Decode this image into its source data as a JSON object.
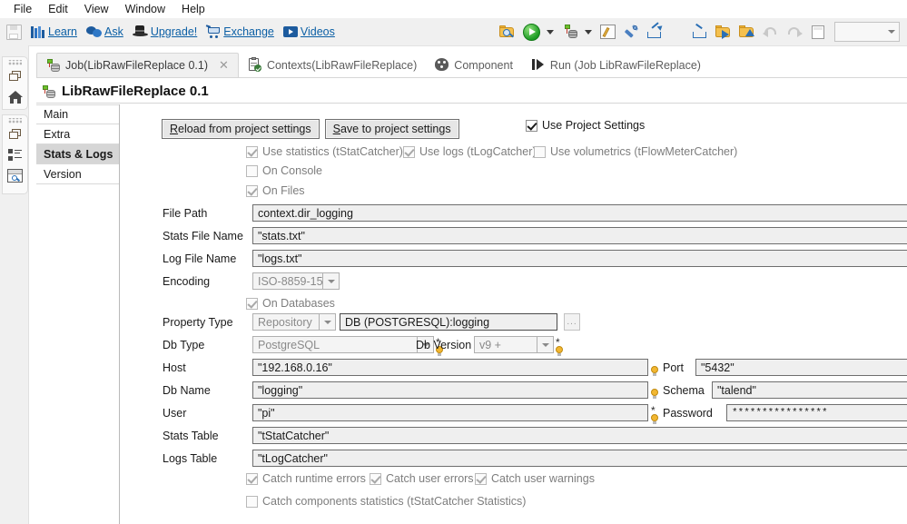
{
  "menu": {
    "items": [
      "File",
      "Edit",
      "View",
      "Window",
      "Help"
    ]
  },
  "toolbar": {
    "links": [
      {
        "icon": "books-icon",
        "label": "Learn"
      },
      {
        "icon": "speech-bubbles-icon",
        "label": "Ask"
      },
      {
        "icon": "magician-hat-icon",
        "label": "Upgrade!"
      },
      {
        "icon": "shopping-cart-icon",
        "label": "Exchange"
      },
      {
        "icon": "video-play-icon",
        "label": "Videos"
      }
    ],
    "save_icon": "save-disk-icon",
    "right_icons": [
      "find-in-repository-icon",
      "run-job-icon",
      "dropdown-caret",
      "database-connection-icon",
      "dropdown-caret",
      "edit-properties-icon",
      "build-tools-icon",
      "export-job-icon",
      "import-items-icon",
      "import-folder-icon",
      "export-folder-icon",
      "undo-icon",
      "redo-icon",
      "new-page-icon"
    ],
    "perspective_value": ""
  },
  "editor": {
    "tabs": [
      {
        "icon": "job-icon",
        "label": "Job(LibRawFileReplace 0.1)",
        "active": true,
        "closable": true
      },
      {
        "icon": "contexts-icon",
        "label": "Contexts(LibRawFileReplace)",
        "active": false,
        "closable": false
      },
      {
        "icon": "component-palette-icon",
        "label": "Component",
        "active": false,
        "closable": false
      },
      {
        "icon": "run-icon",
        "label": "Run (Job LibRawFileReplace)",
        "active": false,
        "closable": false
      }
    ],
    "title": "LibRawFileReplace 0.1",
    "title_icon": "job-icon"
  },
  "sidebar_rail": {
    "group1": [
      "restore-view-icon",
      "home-icon"
    ],
    "group2": [
      "restore-view-icon",
      "outline-icon",
      "inspect-window-icon"
    ]
  },
  "vtabs": [
    {
      "label": "Main",
      "selected": false
    },
    {
      "label": "Extra",
      "selected": false
    },
    {
      "label": "Stats & Logs",
      "selected": true
    },
    {
      "label": "Version",
      "selected": false
    }
  ],
  "form": {
    "buttons": {
      "reload": "Reload from project settings",
      "save": "Save to project settings"
    },
    "use_project_settings": {
      "label": "Use Project Settings",
      "checked": true,
      "enabled": true
    },
    "checkboxes_row1": [
      {
        "label": "Use statistics (tStatCatcher)",
        "checked": true,
        "enabled": false
      },
      {
        "label": "Use logs (tLogCatcher)",
        "checked": true,
        "enabled": false
      },
      {
        "label": "Use volumetrics (tFlowMeterCatcher)",
        "checked": false,
        "enabled": false
      }
    ],
    "on_console": {
      "label": "On Console",
      "checked": false,
      "enabled": false
    },
    "on_files": {
      "label": "On Files",
      "checked": true,
      "enabled": false
    },
    "on_databases": {
      "label": "On Databases",
      "checked": true,
      "enabled": false
    },
    "fields": {
      "file_path": {
        "label": "File Path",
        "value": "context.dir_logging"
      },
      "stats_file_name": {
        "label": "Stats File Name",
        "value": "\"stats.txt\""
      },
      "log_file_name": {
        "label": "Log File Name",
        "value": "\"logs.txt\""
      },
      "encoding": {
        "label": "Encoding",
        "value": "ISO-8859-15"
      },
      "property_type": {
        "label": "Property Type",
        "value": "Repository",
        "repository_value": "DB (POSTGRESQL):logging",
        "browse": "..."
      },
      "db_type": {
        "label": "Db Type",
        "value": "PostgreSQL"
      },
      "db_version": {
        "label": "Db Version",
        "value": "v9 +"
      },
      "host": {
        "label": "Host",
        "value": "\"192.168.0.16\""
      },
      "port": {
        "label": "Port",
        "value": "\"5432\""
      },
      "db_name": {
        "label": "Db Name",
        "value": "\"logging\""
      },
      "schema": {
        "label": "Schema",
        "value": "\"talend\""
      },
      "user": {
        "label": "User",
        "value": "\"pi\""
      },
      "password": {
        "label": "Password",
        "value": "****************"
      },
      "stats_table": {
        "label": "Stats Table",
        "value": "\"tStatCatcher\""
      },
      "logs_table": {
        "label": "Logs Table",
        "value": "\"tLogCatcher\""
      }
    },
    "catch_row": [
      {
        "label": "Catch runtime errors",
        "checked": true,
        "enabled": false
      },
      {
        "label": "Catch user errors",
        "checked": true,
        "enabled": false
      },
      {
        "label": "Catch user warnings",
        "checked": true,
        "enabled": false
      }
    ],
    "catch_components": {
      "label": "Catch components statistics (tStatCatcher Statistics)",
      "checked": false,
      "enabled": false
    }
  },
  "colors": {
    "link": "#0b5fa5",
    "toolbar_bg": "#f0f0f0",
    "selected_tab_bg": "#d6d6d6",
    "field_bg": "#efefef"
  }
}
